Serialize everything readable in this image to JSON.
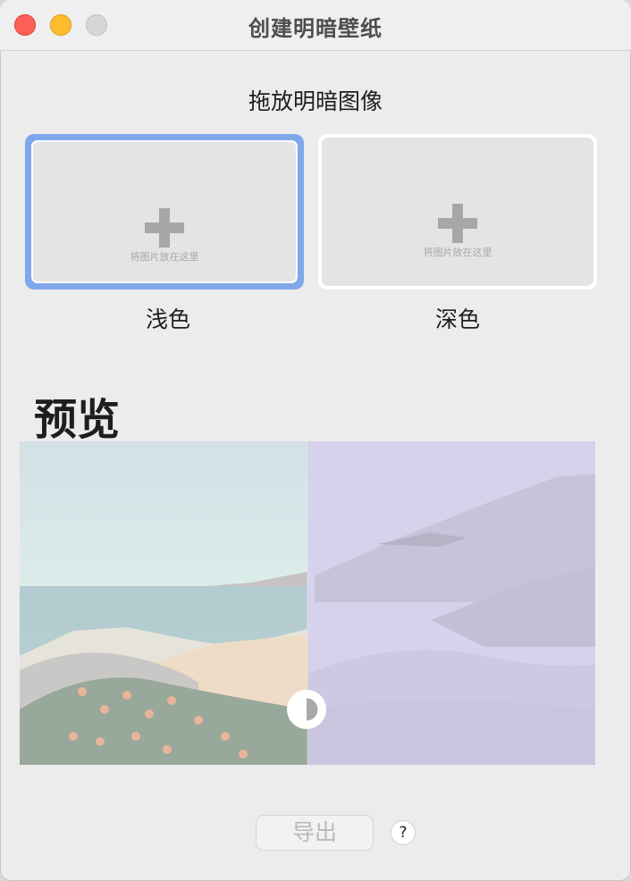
{
  "window": {
    "title": "创建明暗壁纸",
    "controls": [
      "close",
      "minimize",
      "zoom"
    ]
  },
  "drop_section": {
    "heading": "拖放明暗图像",
    "wells": [
      {
        "label": "浅色",
        "hint": "将图片放在这里",
        "selected": true,
        "icon": "plus-icon"
      },
      {
        "label": "深色",
        "hint": "将图片放在这里",
        "selected": false,
        "icon": "plus-icon"
      }
    ]
  },
  "preview": {
    "title": "预览",
    "split_position": 0.5,
    "handle_icon": "light-dark-split-icon"
  },
  "footer": {
    "export_label": "导出",
    "export_enabled": false,
    "help_label": "?"
  },
  "colors": {
    "accent_selection": "#80a7ea",
    "window_background": "#ececec",
    "light_sky": "#d8e6e6",
    "dark_overlay": "#d4d0ea"
  }
}
